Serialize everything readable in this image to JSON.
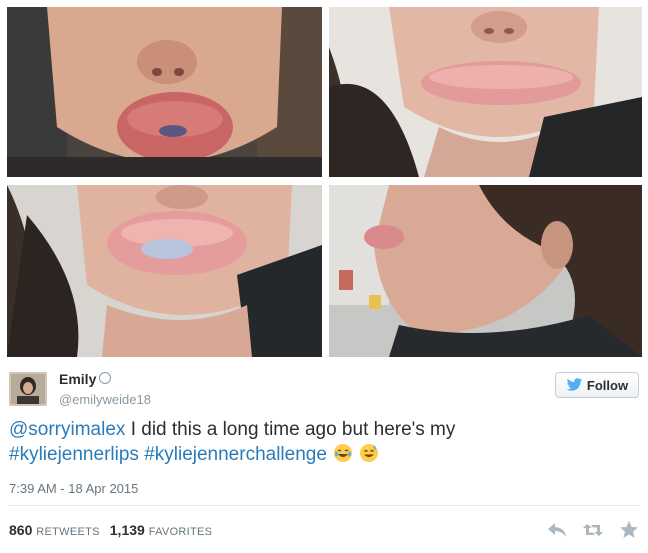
{
  "photos": [
    {
      "id": "photo-1"
    },
    {
      "id": "photo-2"
    },
    {
      "id": "photo-3"
    },
    {
      "id": "photo-4"
    }
  ],
  "tweet": {
    "author_name": "Emily",
    "author_handle": "@emilyweide18",
    "follow_label": "Follow",
    "mention": "@sorryimalex",
    "text_line1": " I did this a long time ago but here's my",
    "hashtag1": "#kyliejennerlips",
    "hashtag2": "#kyliejennerchallenge",
    "emojis": [
      "face-with-tears-of-joy",
      "grinning-face-with-sweat"
    ],
    "timestamp": "7:39 AM - 18 Apr 2015",
    "retweets_count": "860",
    "retweets_label": "RETWEETS",
    "favorites_count": "1,139",
    "favorites_label": "FAVORITES"
  },
  "icons": [
    "twitter-bird-icon",
    "reply-icon",
    "retweet-icon",
    "favorite-star-icon",
    "verified-icon"
  ],
  "colors": {
    "link": "#2b7bb9",
    "text": "#292f33",
    "muted": "#8899a6",
    "follow_bird": "#55acee"
  }
}
